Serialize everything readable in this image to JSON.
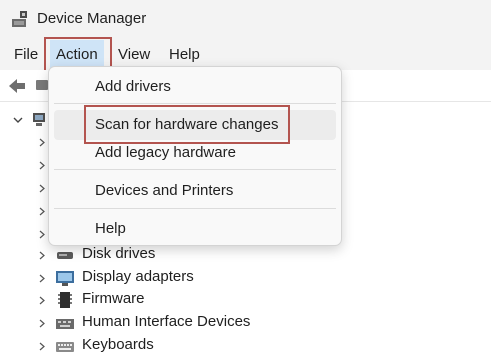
{
  "window": {
    "title": "Device Manager"
  },
  "menubar": {
    "items": [
      {
        "label": "File"
      },
      {
        "label": "Action"
      },
      {
        "label": "View"
      },
      {
        "label": "Help"
      }
    ],
    "active": "Action"
  },
  "action_menu": {
    "items": [
      {
        "label": "Add drivers"
      },
      {
        "label": "Scan for hardware changes",
        "highlighted": true
      },
      {
        "label": "Add legacy hardware"
      },
      {
        "label": "Devices and Printers"
      },
      {
        "label": "Help"
      }
    ]
  },
  "tree": {
    "visible_items": [
      {
        "label": "Disk drives",
        "icon": "disk-drive-icon"
      },
      {
        "label": "Display adapters",
        "icon": "display-adapter-icon"
      },
      {
        "label": "Firmware",
        "icon": "firmware-icon"
      },
      {
        "label": "Human Interface Devices",
        "icon": "hid-icon"
      },
      {
        "label": "Keyboards",
        "icon": "keyboard-icon"
      }
    ]
  },
  "colors": {
    "highlight_outline": "#b3544f",
    "menu_active": "#cfe4f7",
    "chrome": "#f3f3f3"
  }
}
